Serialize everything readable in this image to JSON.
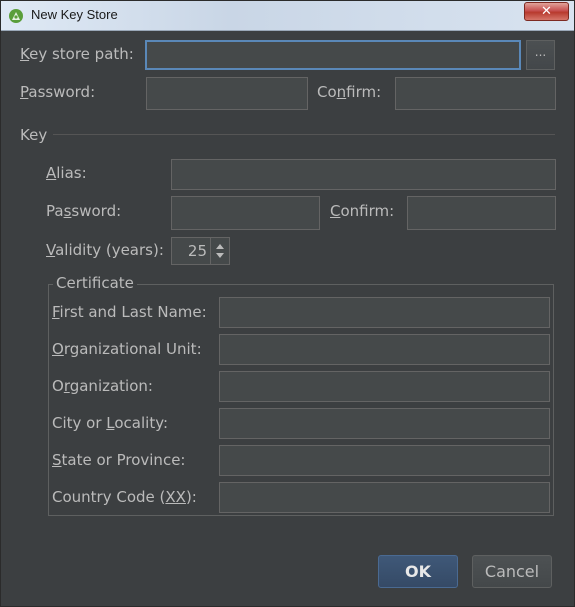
{
  "window": {
    "title": "New Key Store",
    "close_glyph": "✕",
    "icon": "android-studio-icon"
  },
  "keystore": {
    "path_label_key": "K",
    "path_label_rest": "ey store path:",
    "path_value": "",
    "browse_label": "...",
    "password_label_pre": "P",
    "password_label_rest": "assword:",
    "password_value": "",
    "confirm_label_pre": "Co",
    "confirm_label_key": "n",
    "confirm_label_rest": "firm:",
    "confirm_value": ""
  },
  "key": {
    "section_label": "Key",
    "alias_label_key": "A",
    "alias_label_rest": "lias:",
    "alias_value": "",
    "password_label_pre": "Pa",
    "password_label_key": "s",
    "password_label_rest": "sword:",
    "password_value": "",
    "confirm_label_key": "C",
    "confirm_label_rest": "onfirm:",
    "confirm_value": "",
    "validity_label_key": "V",
    "validity_label_rest": "alidity (years):",
    "validity_value": "25"
  },
  "certificate": {
    "section_label": "Certificate",
    "first_last_key": "F",
    "first_last_rest": "irst and Last Name:",
    "org_unit_key": "O",
    "org_unit_rest": "rganizational Unit:",
    "org_pre": "O",
    "org_key": "r",
    "org_rest": "ganization:",
    "city_pre": "City or ",
    "city_key": "L",
    "city_rest": "ocality:",
    "state_key": "S",
    "state_rest": "tate or Province:",
    "country_pre": "Country Code (",
    "country_key": "XX",
    "country_rest": "):",
    "first_last_value": "",
    "org_unit_value": "",
    "org_value": "",
    "city_value": "",
    "state_value": "",
    "country_value": ""
  },
  "buttons": {
    "ok": "OK",
    "cancel": "Cancel"
  },
  "colors": {
    "background": "#3c3f41",
    "field": "#45494a",
    "focus_border": "#5a88b8",
    "ok_button": "#3f5878"
  }
}
